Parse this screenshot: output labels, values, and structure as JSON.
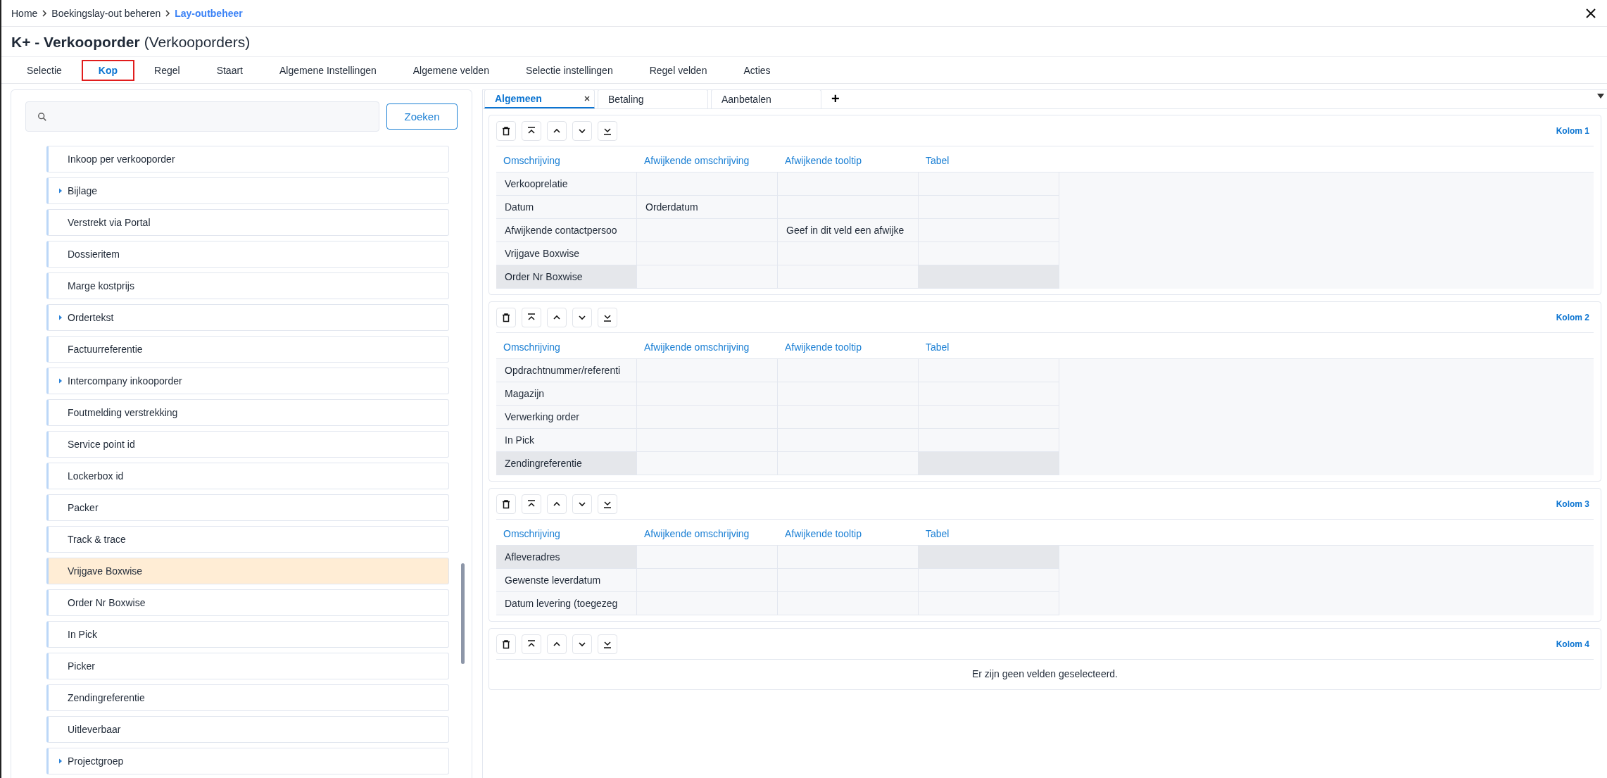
{
  "breadcrumb": [
    {
      "label": "Home",
      "current": false
    },
    {
      "label": "Boekingslay-out beheren",
      "current": false
    },
    {
      "label": "Lay-outbeheer",
      "current": true
    }
  ],
  "title": {
    "main": "K+ - Verkooporder",
    "sub": "(Verkooporders)"
  },
  "tabs": [
    {
      "label": "Selectie",
      "selected": false
    },
    {
      "label": "Kop",
      "selected": true
    },
    {
      "label": "Regel",
      "selected": false
    },
    {
      "label": "Staart",
      "selected": false
    },
    {
      "label": "Algemene Instellingen",
      "selected": false
    },
    {
      "label": "Algemene velden",
      "selected": false
    },
    {
      "label": "Selectie instellingen",
      "selected": false
    },
    {
      "label": "Regel velden",
      "selected": false
    },
    {
      "label": "Acties",
      "selected": false
    }
  ],
  "search": {
    "button": "Zoeken"
  },
  "field_list": [
    {
      "label": "Inkoop per verkooporder",
      "expandable": false,
      "selected": false
    },
    {
      "label": "Bijlage",
      "expandable": true,
      "selected": false
    },
    {
      "label": "Verstrekt via Portal",
      "expandable": false,
      "selected": false
    },
    {
      "label": "Dossieritem",
      "expandable": false,
      "selected": false
    },
    {
      "label": "Marge kostprijs",
      "expandable": false,
      "selected": false
    },
    {
      "label": "Ordertekst",
      "expandable": true,
      "selected": false
    },
    {
      "label": "Factuurreferentie",
      "expandable": false,
      "selected": false
    },
    {
      "label": "Intercompany inkooporder",
      "expandable": true,
      "selected": false
    },
    {
      "label": "Foutmelding verstrekking",
      "expandable": false,
      "selected": false
    },
    {
      "label": "Service point id",
      "expandable": false,
      "selected": false
    },
    {
      "label": "Lockerbox id",
      "expandable": false,
      "selected": false
    },
    {
      "label": "Packer",
      "expandable": false,
      "selected": false
    },
    {
      "label": "Track & trace",
      "expandable": false,
      "selected": false
    },
    {
      "label": "Vrijgave Boxwise",
      "expandable": false,
      "selected": true
    },
    {
      "label": "Order Nr Boxwise",
      "expandable": false,
      "selected": false
    },
    {
      "label": "In Pick",
      "expandable": false,
      "selected": false
    },
    {
      "label": "Picker",
      "expandable": false,
      "selected": false
    },
    {
      "label": "Zendingreferentie",
      "expandable": false,
      "selected": false
    },
    {
      "label": "Uitleverbaar",
      "expandable": false,
      "selected": false
    },
    {
      "label": "Projectgroep",
      "expandable": true,
      "selected": false
    }
  ],
  "layout_tabs": [
    {
      "label": "Algemeen",
      "selected": true,
      "closable": true
    },
    {
      "label": "Betaling",
      "selected": false,
      "closable": false
    },
    {
      "label": "Aanbetalen",
      "selected": false,
      "closable": false
    }
  ],
  "add_tab": "+",
  "sections": [
    {
      "title": "Kolom 1",
      "columns": [
        "Omschrijving",
        "Afwijkende omschrijving",
        "Afwijkende tooltip",
        "Tabel"
      ],
      "rows": [
        {
          "cells": [
            "Verkooprelatie",
            null,
            null,
            null
          ],
          "selected": false
        },
        {
          "cells": [
            "Datum",
            "Orderdatum",
            null,
            null
          ],
          "selected": false
        },
        {
          "cells": [
            "Afwijkende contactpersoo",
            null,
            "Geef in dit veld een afwijke",
            null
          ],
          "selected": false
        },
        {
          "cells": [
            "Vrijgave Boxwise",
            null,
            null,
            null
          ],
          "selected": false
        },
        {
          "cells": [
            "Order Nr Boxwise",
            null,
            null,
            null
          ],
          "selected": true
        }
      ]
    },
    {
      "title": "Kolom 2",
      "columns": [
        "Omschrijving",
        "Afwijkende omschrijving",
        "Afwijkende tooltip",
        "Tabel"
      ],
      "rows": [
        {
          "cells": [
            "Opdrachtnummer/referenti",
            null,
            null,
            null
          ],
          "selected": false
        },
        {
          "cells": [
            "Magazijn",
            null,
            null,
            null
          ],
          "selected": false
        },
        {
          "cells": [
            "Verwerking order",
            null,
            null,
            null
          ],
          "selected": false
        },
        {
          "cells": [
            "In Pick",
            null,
            null,
            null
          ],
          "selected": false
        },
        {
          "cells": [
            "Zendingreferentie",
            null,
            null,
            null
          ],
          "selected": true
        }
      ]
    },
    {
      "title": "Kolom 3",
      "columns": [
        "Omschrijving",
        "Afwijkende omschrijving",
        "Afwijkende tooltip",
        "Tabel"
      ],
      "rows": [
        {
          "cells": [
            "Afleveradres",
            null,
            null,
            null
          ],
          "selected": true
        },
        {
          "cells": [
            "Gewenste leverdatum",
            null,
            null,
            null
          ],
          "selected": false
        },
        {
          "cells": [
            "Datum levering (toegezeg",
            null,
            null,
            null
          ],
          "selected": false
        }
      ]
    },
    {
      "title": "Kolom 4",
      "empty_message": "Er zijn geen velden geselecteerd."
    }
  ]
}
